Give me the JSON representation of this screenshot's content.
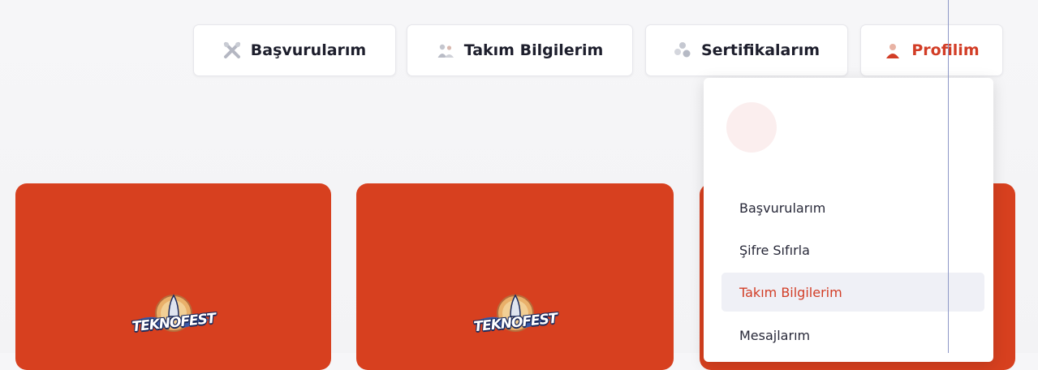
{
  "nav": {
    "items": [
      {
        "label": "Başvurularım",
        "icon": "tools-icon"
      },
      {
        "label": "Takım Bilgilerim",
        "icon": "team-icon"
      },
      {
        "label": "Sertifikalarım",
        "icon": "certificate-icon"
      },
      {
        "label": "Profilim",
        "icon": "user-icon"
      }
    ],
    "active_color": "#d23d26"
  },
  "cards": [
    {
      "logo_text": "TEKNOFEST"
    },
    {
      "logo_text": "TEKNOFEST"
    },
    {
      "logo_text": ""
    }
  ],
  "card_color": "#d7401f",
  "dropdown": {
    "items": [
      {
        "label": "Başvurularım"
      },
      {
        "label": "Şifre Sıfırla"
      },
      {
        "label": "Takım Bilgilerim",
        "active": true
      },
      {
        "label": "Mesajlarım"
      }
    ]
  }
}
